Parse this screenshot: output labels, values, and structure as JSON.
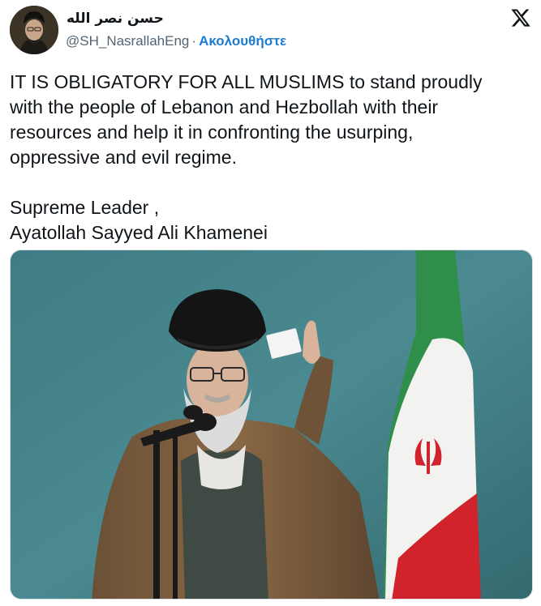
{
  "author": {
    "display_name": "حسن نصر الله",
    "handle": "@SH_NasrallahEng",
    "separator": "·",
    "follow_label": "Ακολουθήστε"
  },
  "tweet": {
    "text": "IT IS OBLIGATORY FOR ALL MUSLIMS to stand proudly\nwith the people of Lebanon and Hezbollah with their\nresources and help it in confronting the usurping,\noppressive and evil regime.\n\nSupreme Leader ,\nAyatollah Sayyed Ali Khamenei"
  },
  "icons": {
    "brand": "x-logo-icon"
  },
  "colors": {
    "link": "#1d7bd0",
    "secondary_text": "#536471",
    "primary_text": "#0f1419"
  }
}
